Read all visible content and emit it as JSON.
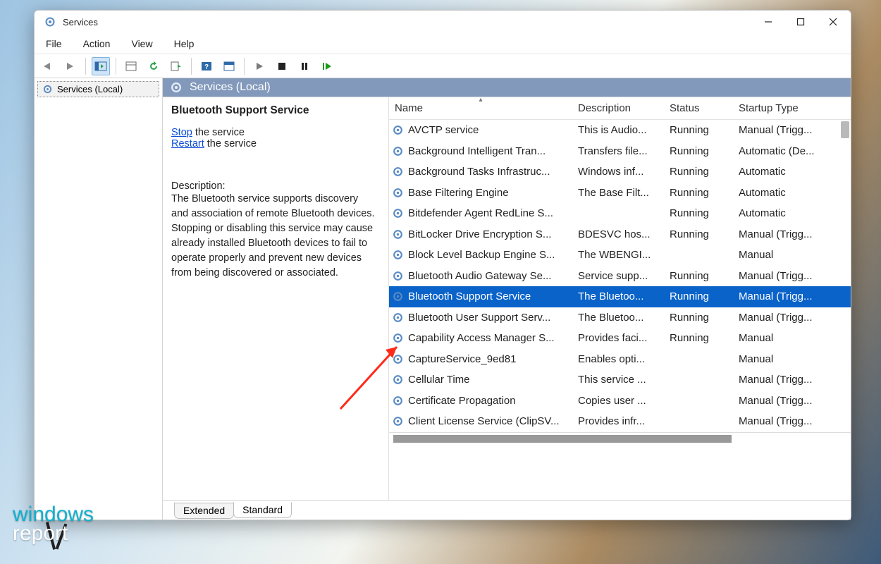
{
  "window": {
    "title": "Services"
  },
  "menubar": [
    "File",
    "Action",
    "View",
    "Help"
  ],
  "nav": {
    "item_label": "Services (Local)"
  },
  "pane_header": "Services (Local)",
  "detail": {
    "selected_name": "Bluetooth Support Service",
    "link_stop": "Stop",
    "stop_suffix": " the service",
    "link_restart": "Restart",
    "restart_suffix": " the service",
    "desc_label": "Description:",
    "desc_text": "The Bluetooth service supports discovery and association of remote Bluetooth devices.  Stopping or disabling this service may cause already installed Bluetooth devices to fail to operate properly and prevent new devices from being discovered or associated."
  },
  "columns": [
    "Name",
    "Description",
    "Status",
    "Startup Type"
  ],
  "services": [
    {
      "name": "AVCTP service",
      "desc": "This is Audio...",
      "status": "Running",
      "startup": "Manual (Trigg...",
      "sel": false
    },
    {
      "name": "Background Intelligent Tran...",
      "desc": "Transfers file...",
      "status": "Running",
      "startup": "Automatic (De...",
      "sel": false
    },
    {
      "name": "Background Tasks Infrastruc...",
      "desc": "Windows inf...",
      "status": "Running",
      "startup": "Automatic",
      "sel": false
    },
    {
      "name": "Base Filtering Engine",
      "desc": "The Base Filt...",
      "status": "Running",
      "startup": "Automatic",
      "sel": false
    },
    {
      "name": "Bitdefender Agent RedLine S...",
      "desc": "",
      "status": "Running",
      "startup": "Automatic",
      "sel": false
    },
    {
      "name": "BitLocker Drive Encryption S...",
      "desc": "BDESVC hos...",
      "status": "Running",
      "startup": "Manual (Trigg...",
      "sel": false
    },
    {
      "name": "Block Level Backup Engine S...",
      "desc": "The WBENGI...",
      "status": "",
      "startup": "Manual",
      "sel": false
    },
    {
      "name": "Bluetooth Audio Gateway Se...",
      "desc": "Service supp...",
      "status": "Running",
      "startup": "Manual (Trigg...",
      "sel": false
    },
    {
      "name": "Bluetooth Support Service",
      "desc": "The Bluetoo...",
      "status": "Running",
      "startup": "Manual (Trigg...",
      "sel": true
    },
    {
      "name": "Bluetooth User Support Serv...",
      "desc": "The Bluetoo...",
      "status": "Running",
      "startup": "Manual (Trigg...",
      "sel": false
    },
    {
      "name": "Capability Access Manager S...",
      "desc": "Provides faci...",
      "status": "Running",
      "startup": "Manual",
      "sel": false
    },
    {
      "name": "CaptureService_9ed81",
      "desc": "Enables opti...",
      "status": "",
      "startup": "Manual",
      "sel": false
    },
    {
      "name": "Cellular Time",
      "desc": "This service ...",
      "status": "",
      "startup": "Manual (Trigg...",
      "sel": false
    },
    {
      "name": "Certificate Propagation",
      "desc": "Copies user ...",
      "status": "",
      "startup": "Manual (Trigg...",
      "sel": false
    },
    {
      "name": "Client License Service (ClipSV...",
      "desc": "Provides infr...",
      "status": "",
      "startup": "Manual (Trigg...",
      "sel": false
    }
  ],
  "tabs": {
    "extended": "Extended",
    "standard": "Standard"
  },
  "watermark": {
    "line1": "windows",
    "line2": "report"
  }
}
